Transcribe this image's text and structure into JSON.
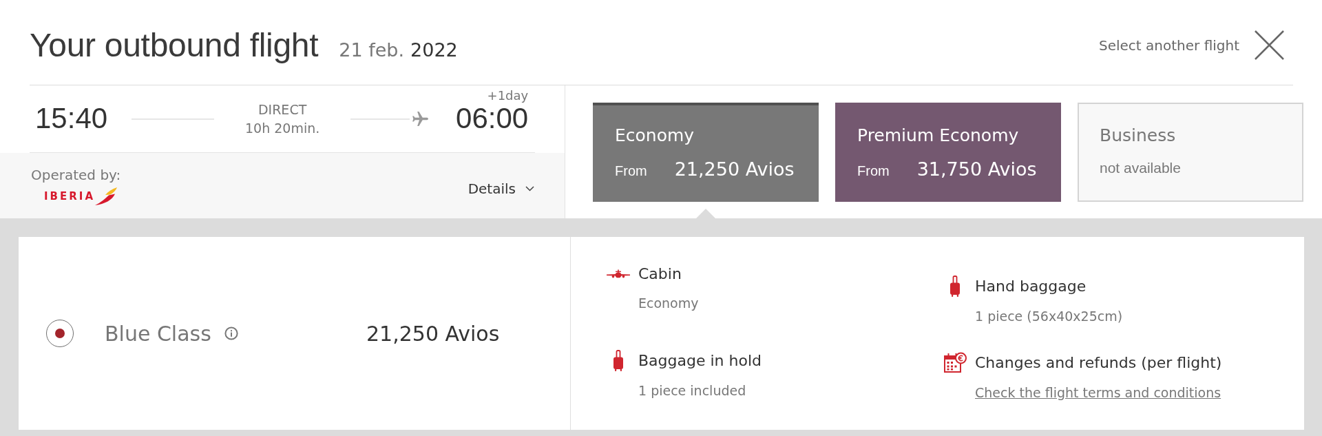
{
  "header": {
    "title": "Your outbound flight",
    "date": "21 feb.",
    "year": "2022",
    "close_label": "Select another flight"
  },
  "flight": {
    "departure_time": "15:40",
    "stops": "DIRECT",
    "duration": "10h 20min.",
    "day_offset": "+1day",
    "arrival_time": "06:00",
    "operated_by_label": "Operated by:",
    "airline": "IBERIA",
    "details_label": "Details"
  },
  "fares": [
    {
      "cabin": "Economy",
      "from_label": "From",
      "price": "21,250 Avios",
      "available": true,
      "selected": true,
      "color": "#787878"
    },
    {
      "cabin": "Premium Economy",
      "from_label": "From",
      "price": "31,750 Avios",
      "available": true,
      "selected": false,
      "color": "#745870"
    },
    {
      "cabin": "Business",
      "note": "not available",
      "available": false,
      "selected": false
    }
  ],
  "options": [
    {
      "name": "Blue Class",
      "price": "21,250 Avios",
      "selected": true
    }
  ],
  "benefits": {
    "columns": [
      {
        "items": [
          {
            "kind": "cabin",
            "title": "Cabin",
            "detail": "Economy"
          },
          {
            "kind": "baggage",
            "title": "Baggage in hold",
            "detail": "1 piece included"
          }
        ]
      },
      {
        "items": [
          {
            "kind": "baggage",
            "title": "Hand baggage",
            "detail": "1 piece (56x40x25cm)"
          },
          {
            "kind": "changes",
            "title": "Changes and refunds (per flight)",
            "link": "Check the flight terms and conditions"
          }
        ]
      }
    ]
  }
}
